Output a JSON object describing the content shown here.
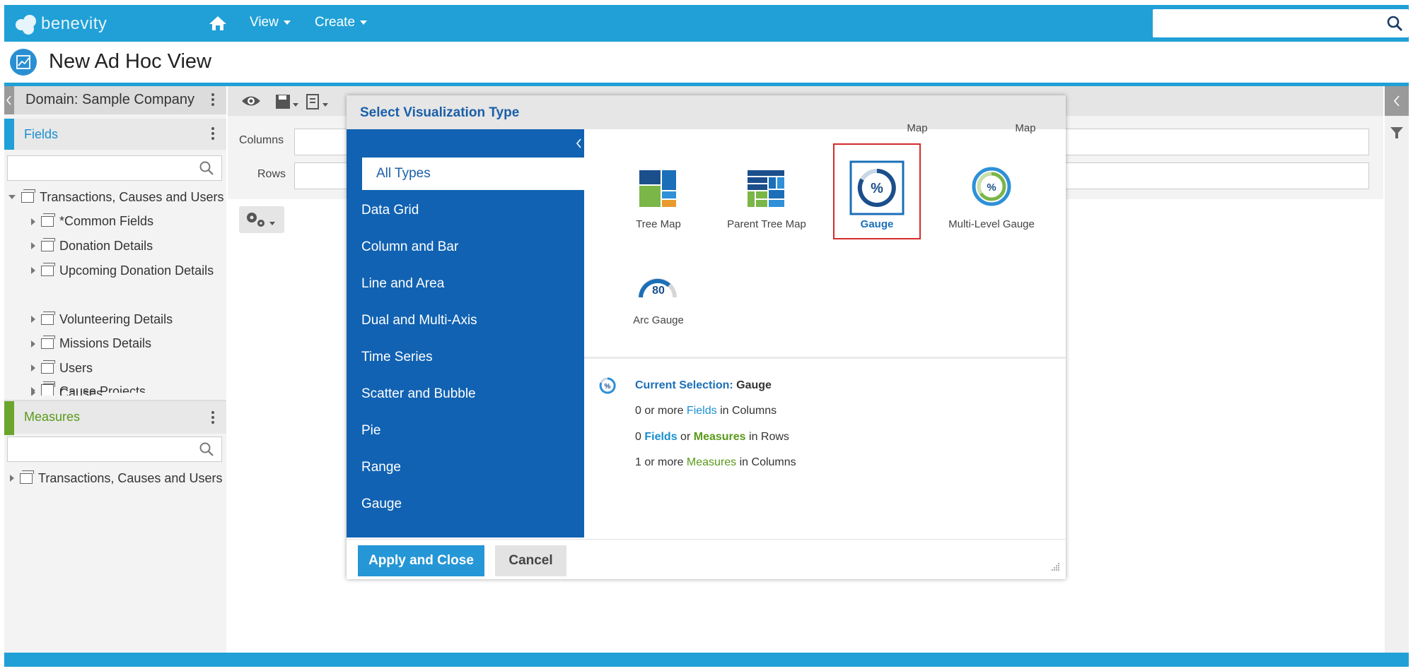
{
  "app": {
    "logo_text": "benevity",
    "nav": {
      "view_label": "View",
      "create_label": "Create"
    },
    "search_placeholder": ""
  },
  "page": {
    "title": "New Ad Hoc View"
  },
  "left_panel": {
    "domain_label": "Domain: Sample Company",
    "fields": {
      "title": "Fields",
      "search_placeholder": "",
      "tree_root": "Transactions, Causes and Users",
      "items": [
        "*Common Fields",
        "Donation Details",
        "Upcoming Donation Details",
        "Volunteering Details",
        "Missions Details",
        "Users",
        "Causes",
        "Cause Projects"
      ]
    },
    "measures": {
      "title": "Measures",
      "search_placeholder": "",
      "tree_root": "Transactions, Causes and Users"
    }
  },
  "workspace": {
    "columns_label": "Columns",
    "rows_label": "Rows"
  },
  "dialog": {
    "title": "Select Visualization Type",
    "categories": [
      "All Types",
      "Data Grid",
      "Column and Bar",
      "Line and Area",
      "Dual and Multi-Axis",
      "Time Series",
      "Scatter and Bubble",
      "Pie",
      "Range",
      "Gauge"
    ],
    "top_partial_labels": [
      "Map",
      "Map"
    ],
    "viz_types": [
      {
        "name": "Tree Map"
      },
      {
        "name": "Parent Tree Map"
      },
      {
        "name": "Gauge"
      },
      {
        "name": "Multi-Level Gauge"
      },
      {
        "name": "Arc Gauge",
        "sample_value": "80"
      }
    ],
    "current_selection": {
      "label": "Current Selection:",
      "value": "Gauge",
      "rule1_a": "0 or more",
      "rule1_b": "Fields",
      "rule1_c": "in Columns",
      "rule2_a": "0",
      "rule2_b": "Fields",
      "rule2_c": "or",
      "rule2_d": "Measures",
      "rule2_e": "in Rows",
      "rule3_a": "1 or more",
      "rule3_b": "Measures",
      "rule3_c": "in Columns"
    },
    "apply_label": "Apply and Close",
    "cancel_label": "Cancel"
  },
  "colors": {
    "brand_blue": "#20a0d6",
    "dialog_nav_blue": "#1162b2",
    "fields_accent": "#20a0d6",
    "measures_accent": "#6aa62e",
    "selection_red": "#d62b2b"
  }
}
